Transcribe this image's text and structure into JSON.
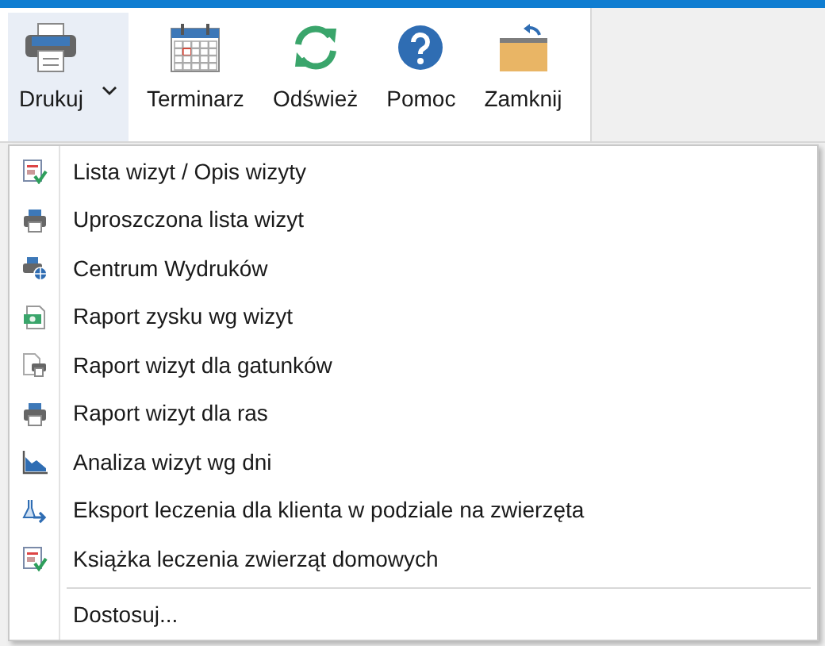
{
  "toolbar": [
    {
      "label": "Drukuj",
      "kind": "print",
      "selected": true,
      "has_dropdown": true
    },
    {
      "label": "Terminarz",
      "kind": "calendar",
      "selected": false,
      "has_dropdown": false
    },
    {
      "label": "Odśwież",
      "kind": "refresh",
      "selected": false,
      "has_dropdown": false
    },
    {
      "label": "Pomoc",
      "kind": "help",
      "selected": false,
      "has_dropdown": false
    },
    {
      "label": "Zamknij",
      "kind": "close",
      "selected": false,
      "has_dropdown": false
    }
  ],
  "menu": {
    "items": [
      {
        "label": "Lista wizyt / Opis wizyty",
        "kind": "report-check"
      },
      {
        "label": "Uproszczona lista wizyt",
        "kind": "printer"
      },
      {
        "label": "Centrum Wydruków",
        "kind": "printer-globe"
      },
      {
        "label": "Raport zysku wg wizyt",
        "kind": "money"
      },
      {
        "label": "Raport wizyt dla gatunków",
        "kind": "doc-printer"
      },
      {
        "label": "Raport wizyt dla ras",
        "kind": "printer"
      },
      {
        "label": "Analiza wizyt wg dni",
        "kind": "chart"
      },
      {
        "label": "Eksport leczenia dla klienta w podziale na zwierzęta",
        "kind": "flask"
      },
      {
        "label": "Książka leczenia zwierząt domowych",
        "kind": "report-check"
      }
    ],
    "footer_item": {
      "label": "Dostosuj..."
    }
  }
}
